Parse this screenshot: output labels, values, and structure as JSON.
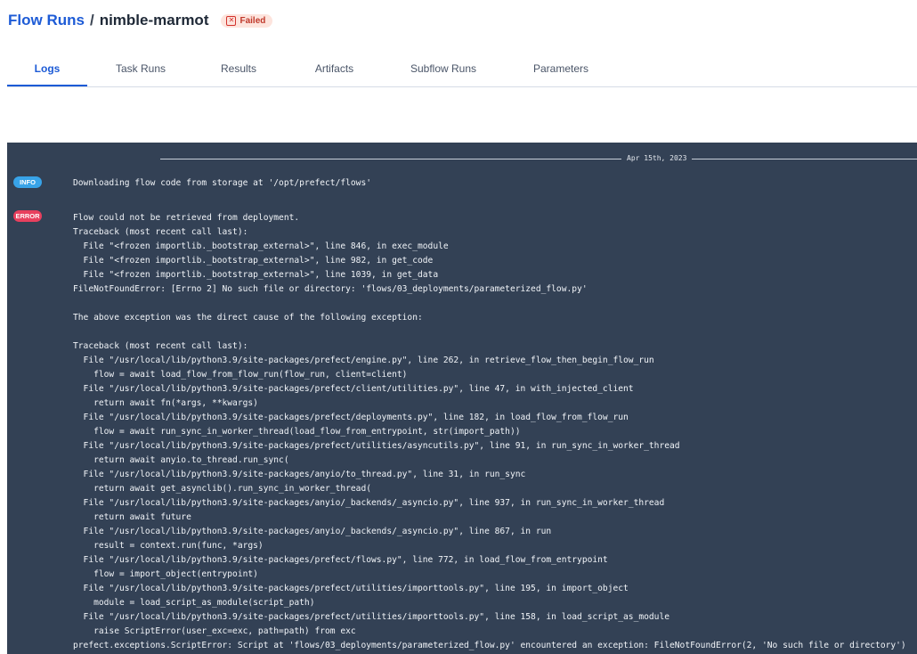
{
  "breadcrumb": {
    "root": "Flow Runs",
    "separator": "/",
    "name": "nimble-marmot"
  },
  "status": {
    "label": "Failed",
    "icon": "x-square-icon"
  },
  "tabs": [
    {
      "label": "Logs",
      "active": true
    },
    {
      "label": "Task Runs",
      "active": false
    },
    {
      "label": "Results",
      "active": false
    },
    {
      "label": "Artifacts",
      "active": false
    },
    {
      "label": "Subflow Runs",
      "active": false
    },
    {
      "label": "Parameters",
      "active": false
    }
  ],
  "logs": {
    "date": "Apr 15th, 2023",
    "entries": [
      {
        "level": "INFO",
        "message": "Downloading flow code from storage at '/opt/prefect/flows'"
      },
      {
        "level": "ERROR",
        "message": "Flow could not be retrieved from deployment.\nTraceback (most recent call last):\n  File \"<frozen importlib._bootstrap_external>\", line 846, in exec_module\n  File \"<frozen importlib._bootstrap_external>\", line 982, in get_code\n  File \"<frozen importlib._bootstrap_external>\", line 1039, in get_data\nFileNotFoundError: [Errno 2] No such file or directory: 'flows/03_deployments/parameterized_flow.py'\n\nThe above exception was the direct cause of the following exception:\n\nTraceback (most recent call last):\n  File \"/usr/local/lib/python3.9/site-packages/prefect/engine.py\", line 262, in retrieve_flow_then_begin_flow_run\n    flow = await load_flow_from_flow_run(flow_run, client=client)\n  File \"/usr/local/lib/python3.9/site-packages/prefect/client/utilities.py\", line 47, in with_injected_client\n    return await fn(*args, **kwargs)\n  File \"/usr/local/lib/python3.9/site-packages/prefect/deployments.py\", line 182, in load_flow_from_flow_run\n    flow = await run_sync_in_worker_thread(load_flow_from_entrypoint, str(import_path))\n  File \"/usr/local/lib/python3.9/site-packages/prefect/utilities/asyncutils.py\", line 91, in run_sync_in_worker_thread\n    return await anyio.to_thread.run_sync(\n  File \"/usr/local/lib/python3.9/site-packages/anyio/to_thread.py\", line 31, in run_sync\n    return await get_asynclib().run_sync_in_worker_thread(\n  File \"/usr/local/lib/python3.9/site-packages/anyio/_backends/_asyncio.py\", line 937, in run_sync_in_worker_thread\n    return await future\n  File \"/usr/local/lib/python3.9/site-packages/anyio/_backends/_asyncio.py\", line 867, in run\n    result = context.run(func, *args)\n  File \"/usr/local/lib/python3.9/site-packages/prefect/flows.py\", line 772, in load_flow_from_entrypoint\n    flow = import_object(entrypoint)\n  File \"/usr/local/lib/python3.9/site-packages/prefect/utilities/importtools.py\", line 195, in import_object\n    module = load_script_as_module(script_path)\n  File \"/usr/local/lib/python3.9/site-packages/prefect/utilities/importtools.py\", line 158, in load_script_as_module\n    raise ScriptError(user_exc=exc, path=path) from exc\nprefect.exceptions.ScriptError: Script at 'flows/03_deployments/parameterized_flow.py' encountered an exception: FileNotFoundError(2, 'No such file or directory')"
      }
    ]
  }
}
